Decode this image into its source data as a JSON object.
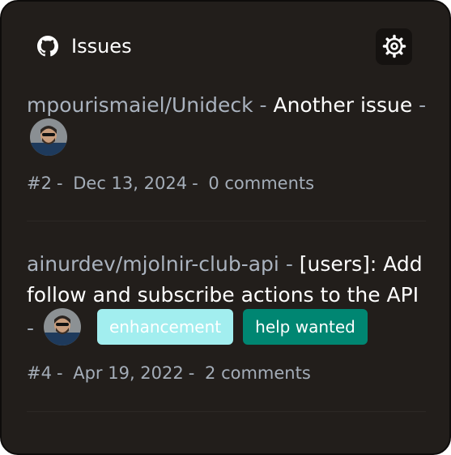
{
  "header": {
    "title": "Issues",
    "icon": "github-icon",
    "settings_icon": "gear-icon"
  },
  "issues": [
    {
      "repo": "mpourismaiel/Unideck",
      "separator": "-",
      "title": "Another issue",
      "number": "#2",
      "date": "Dec 13, 2024",
      "comments": "0 comments",
      "labels": []
    },
    {
      "repo": "ainurdev/mjolnir-club-api",
      "separator": "-",
      "title": "[users]: Add follow and subscribe actions to the API",
      "number": "#4",
      "date": "Apr 19, 2022",
      "comments": "2 comments",
      "labels": [
        {
          "text": "enhancement",
          "bg": "#a2eeef",
          "fg": "#ffffff"
        },
        {
          "text": "help wanted",
          "bg": "#008672",
          "fg": "#ffffff"
        }
      ]
    }
  ],
  "colors": {
    "background": "#221e1b",
    "repo_text": "#aab3bf",
    "meta_text": "#a4adb8"
  }
}
